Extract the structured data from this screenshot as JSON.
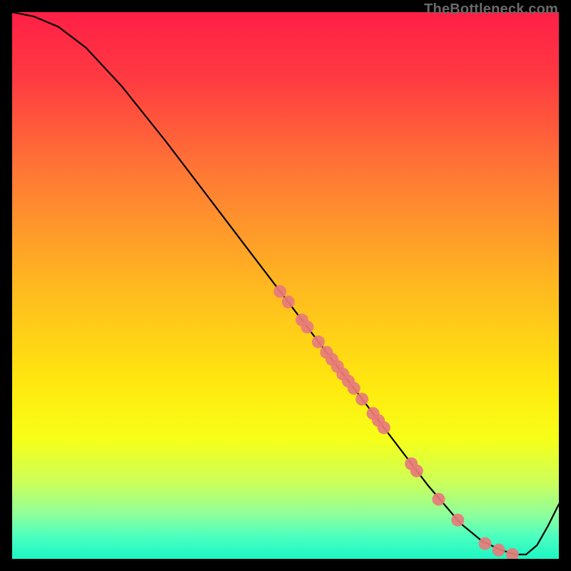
{
  "watermark": "TheBottleneck.com",
  "chart_data": {
    "type": "line",
    "title": "",
    "xlabel": "",
    "ylabel": "",
    "xlim": [
      0,
      100
    ],
    "ylim": [
      0,
      100
    ],
    "background_gradient": {
      "top": "#ff1f46",
      "mid": "#ffe80f",
      "bottom": "#1cf7c4"
    },
    "curve": {
      "x": [
        0.0,
        4.0,
        8.5,
        13.5,
        20.0,
        28.0,
        36.0,
        44.0,
        52.0,
        60.0,
        68.0,
        76.0,
        82.0,
        86.0,
        89.5,
        92.0,
        94.0,
        96.0,
        98.0,
        100.0
      ],
      "y": [
        100.0,
        99.2,
        97.3,
        93.5,
        86.5,
        76.5,
        66.0,
        55.5,
        45.0,
        34.5,
        24.0,
        13.5,
        6.5,
        3.2,
        1.6,
        0.8,
        0.8,
        2.5,
        6.0,
        10.0
      ]
    },
    "points": {
      "color": "#e77b7b",
      "radius": 9,
      "x": [
        49.0,
        50.5,
        53.0,
        54.0,
        56.0,
        57.5,
        58.5,
        59.5,
        60.5,
        61.5,
        62.5,
        64.0,
        66.0,
        67.0,
        68.0,
        73.0,
        74.0,
        78.0,
        81.5,
        86.5,
        89.0,
        91.5
      ],
      "y": [
        48.9,
        47.0,
        43.7,
        42.4,
        39.7,
        37.8,
        36.5,
        35.2,
        33.8,
        32.5,
        31.2,
        29.2,
        26.6,
        25.3,
        24.0,
        17.4,
        16.1,
        10.9,
        7.1,
        2.8,
        1.6,
        0.8
      ]
    }
  }
}
